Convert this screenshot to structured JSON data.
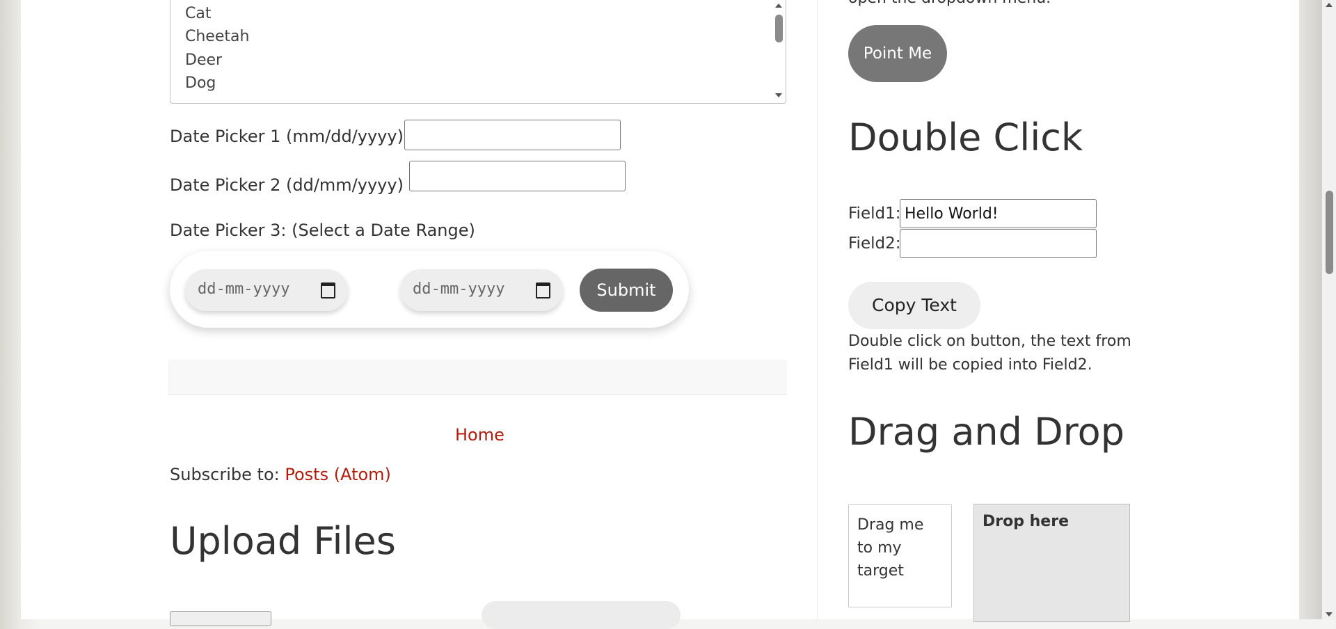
{
  "listbox": {
    "items": [
      "Cat",
      "Cheetah",
      "Deer",
      "Dog"
    ]
  },
  "date_pickers": {
    "picker1_label": "Date Picker 1 (mm/dd/yyyy):",
    "picker2_label": "Date Picker 2 (dd/mm/yyyy) :",
    "picker3_label": "Date Picker 3: (Select a Date Range)",
    "range_start_placeholder": "dd-mm-yyyy",
    "range_end_placeholder": "dd-mm-yyyy",
    "submit_label": "Submit"
  },
  "footer": {
    "home_link": "Home",
    "subscribe_prefix": "Subscribe to:",
    "subscribe_link": "Posts (Atom)"
  },
  "upload": {
    "heading": "Upload Files"
  },
  "sidebar": {
    "dropdown_text_partial": "open the dropdown menu.",
    "point_me_label": "Point Me",
    "double_click": {
      "heading": "Double Click",
      "field1_label": "Field1:",
      "field1_value": "Hello World!",
      "field2_label": "Field2:",
      "field2_value": "",
      "copy_button": "Copy Text",
      "description_line1": "Double click on button, the text from",
      "description_line2": "Field1 will be copied into Field2."
    },
    "drag_drop": {
      "heading": "Drag and Drop",
      "drag_text": "Drag me to my target",
      "drop_text": "Drop here"
    }
  }
}
